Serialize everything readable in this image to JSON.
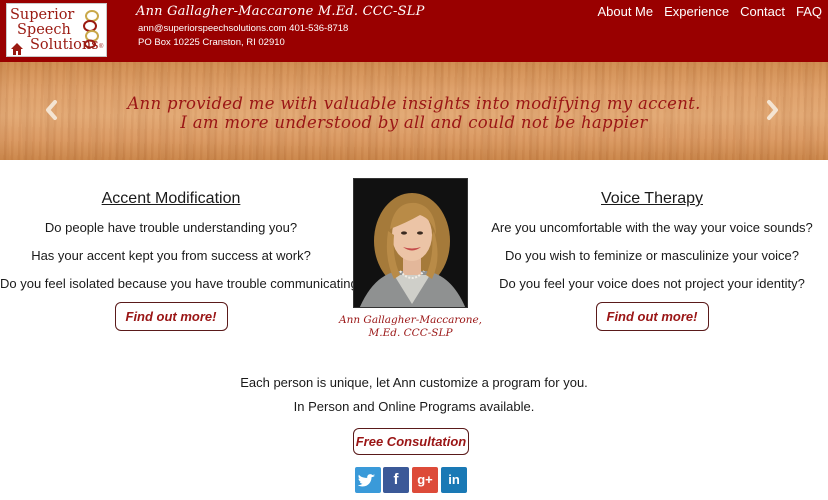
{
  "header": {
    "logo": {
      "line1": "Superior",
      "line2": "Speech",
      "line3": "Solutions",
      "reg": "®"
    },
    "name": "Ann Gallagher-Maccarone M.Ed. CCC-SLP",
    "email_phone": "ann@superiorspeechsolutions.com 401-536-8718",
    "address": "PO Box 10225 Cranston, RI 02910"
  },
  "nav": {
    "items": [
      "About Me",
      "Experience",
      "Contact",
      "FAQ"
    ]
  },
  "banner": {
    "quote_line1": "Ann provided me with valuable insights into modifying my accent.",
    "quote_line2": "I am more understood by all and could not be happier"
  },
  "left": {
    "title": "Accent Modification",
    "lines": [
      "Do people have trouble understanding you?",
      "Has your accent kept you from success at work?",
      "Do you feel isolated because you have trouble communicating?"
    ],
    "button": "Find out more!"
  },
  "right": {
    "title": "Voice Therapy",
    "lines": [
      "Are you uncomfortable with the way your voice sounds?",
      "Do you wish to feminize or masculinize your voice?",
      "Do you feel your voice does not project your identity?"
    ],
    "button": "Find out more!"
  },
  "photo": {
    "caption_line1": "Ann Gallagher-Maccarone,",
    "caption_line2": "M.Ed. CCC-SLP"
  },
  "bottom": {
    "line1": "Each person is unique, let Ann customize a program for you.",
    "line2": "In Person and Online Programs available.",
    "button": "Free Consultation"
  },
  "social": [
    {
      "icon": "twitter-icon",
      "glyph": "t",
      "color": "#3a9ad9"
    },
    {
      "icon": "facebook-icon",
      "glyph": "f",
      "color": "#3b5998"
    },
    {
      "icon": "google-plus-icon",
      "glyph": "g+",
      "color": "#dd4b39"
    },
    {
      "icon": "linkedin-icon",
      "glyph": "in",
      "color": "#1a79b5"
    }
  ],
  "colors": {
    "brand_red": "#990000",
    "accent_text": "#9a1515"
  }
}
